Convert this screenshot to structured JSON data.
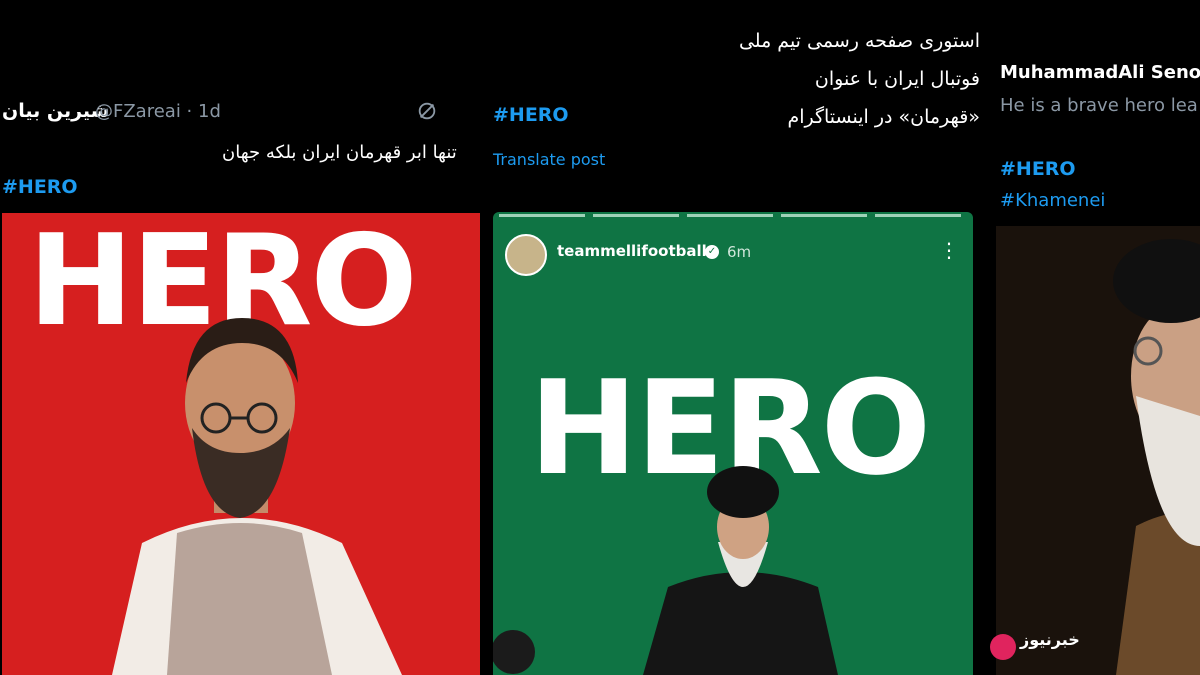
{
  "column1": {
    "author_name": "شیرین بیان",
    "handle_time": "@FZareai · 1d",
    "text": "تنها ابر قهرمان ایران بلکه جهان",
    "hashtag": "#HERO",
    "image_word": "HERO"
  },
  "column2": {
    "text_line1": "استوری صفحه رسمی تیم ملی فوتبال ایران با عنوان",
    "text_line2": "«قهرمان» در اینستاگرام",
    "hashtag": "#HERO",
    "translate": "Translate post",
    "story_user": "teammellifootball",
    "story_time": "6m",
    "image_word": "HERO"
  },
  "column3": {
    "author_name": "MuhammadAli Seno",
    "text": "He is a brave hero lea",
    "hashtag1": "#HERO",
    "hashtag2": "#Khamenei"
  },
  "watermark": "خبرنیوز"
}
